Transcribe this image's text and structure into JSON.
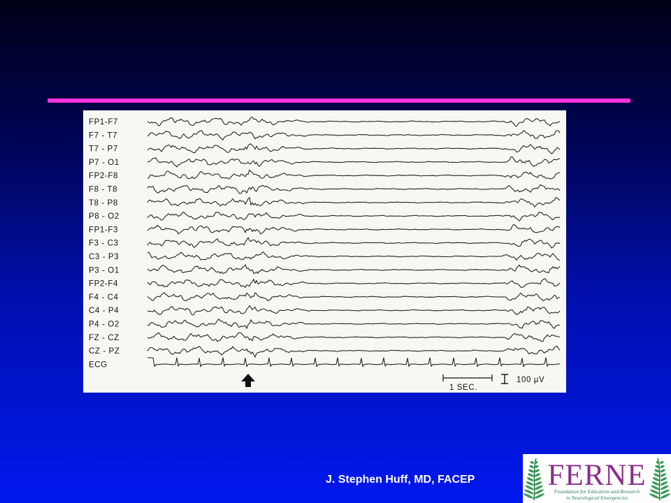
{
  "slide": {
    "author": "J. Stephen Huff, MD, FACEP",
    "accent_color": "#ff33dd"
  },
  "eeg_figure": {
    "channels": [
      "FP1-F7",
      "F7 - T7",
      "T7 - P7",
      "P7 - O1",
      "FP2-F8",
      "F8 - T8",
      "T8 - P8",
      "P8 - O2",
      "FP1-F3",
      "F3 - C3",
      "C3 - P3",
      "P3 - O1",
      "FP2-F4",
      "F4 - C4",
      "C4 - P4",
      "P4 - O2",
      "FZ - CZ",
      "CZ - PZ",
      "ECG"
    ],
    "time_scale_label": "1 SEC.",
    "amplitude_scale_label": "100 µV",
    "marker_icon": "up-arrow-icon"
  },
  "logo": {
    "word": "FERNE",
    "subtitle_line1": "Foundation for Education and Research",
    "subtitle_line2": "in Neurological Emergencies",
    "leaf_icon": "fern-leaf-icon"
  }
}
